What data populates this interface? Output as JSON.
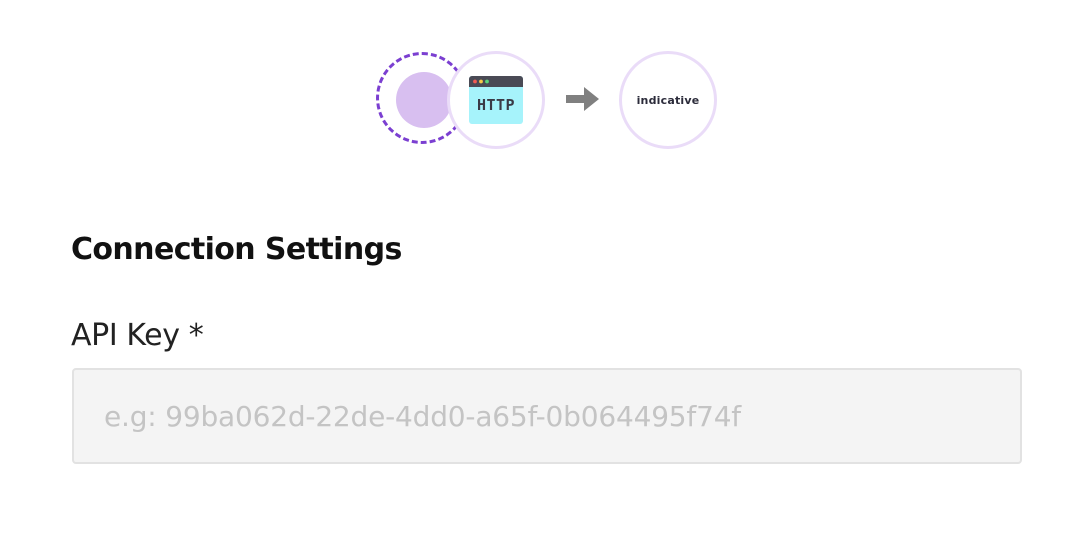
{
  "flow": {
    "source_icon": "source-placeholder-icon",
    "http_icon": "http-browser-window-icon",
    "http_label": "HTTP",
    "arrow_icon": "arrow-right-icon",
    "destination_logo_text": "indicative",
    "colors": {
      "ring_dashed": "#7b3fd1",
      "source_dot": "#d8bff0",
      "node_border": "#eadcf8",
      "http_window_bg": "#a6f3fb",
      "http_titlebar": "#4a4a55",
      "arrow": "#808080"
    }
  },
  "form": {
    "section_title": "Connection Settings",
    "api_key_label": "API Key *",
    "api_key_value": "",
    "api_key_placeholder": "e.g: 99ba062d-22de-4dd0-a65f-0b064495f74f"
  }
}
